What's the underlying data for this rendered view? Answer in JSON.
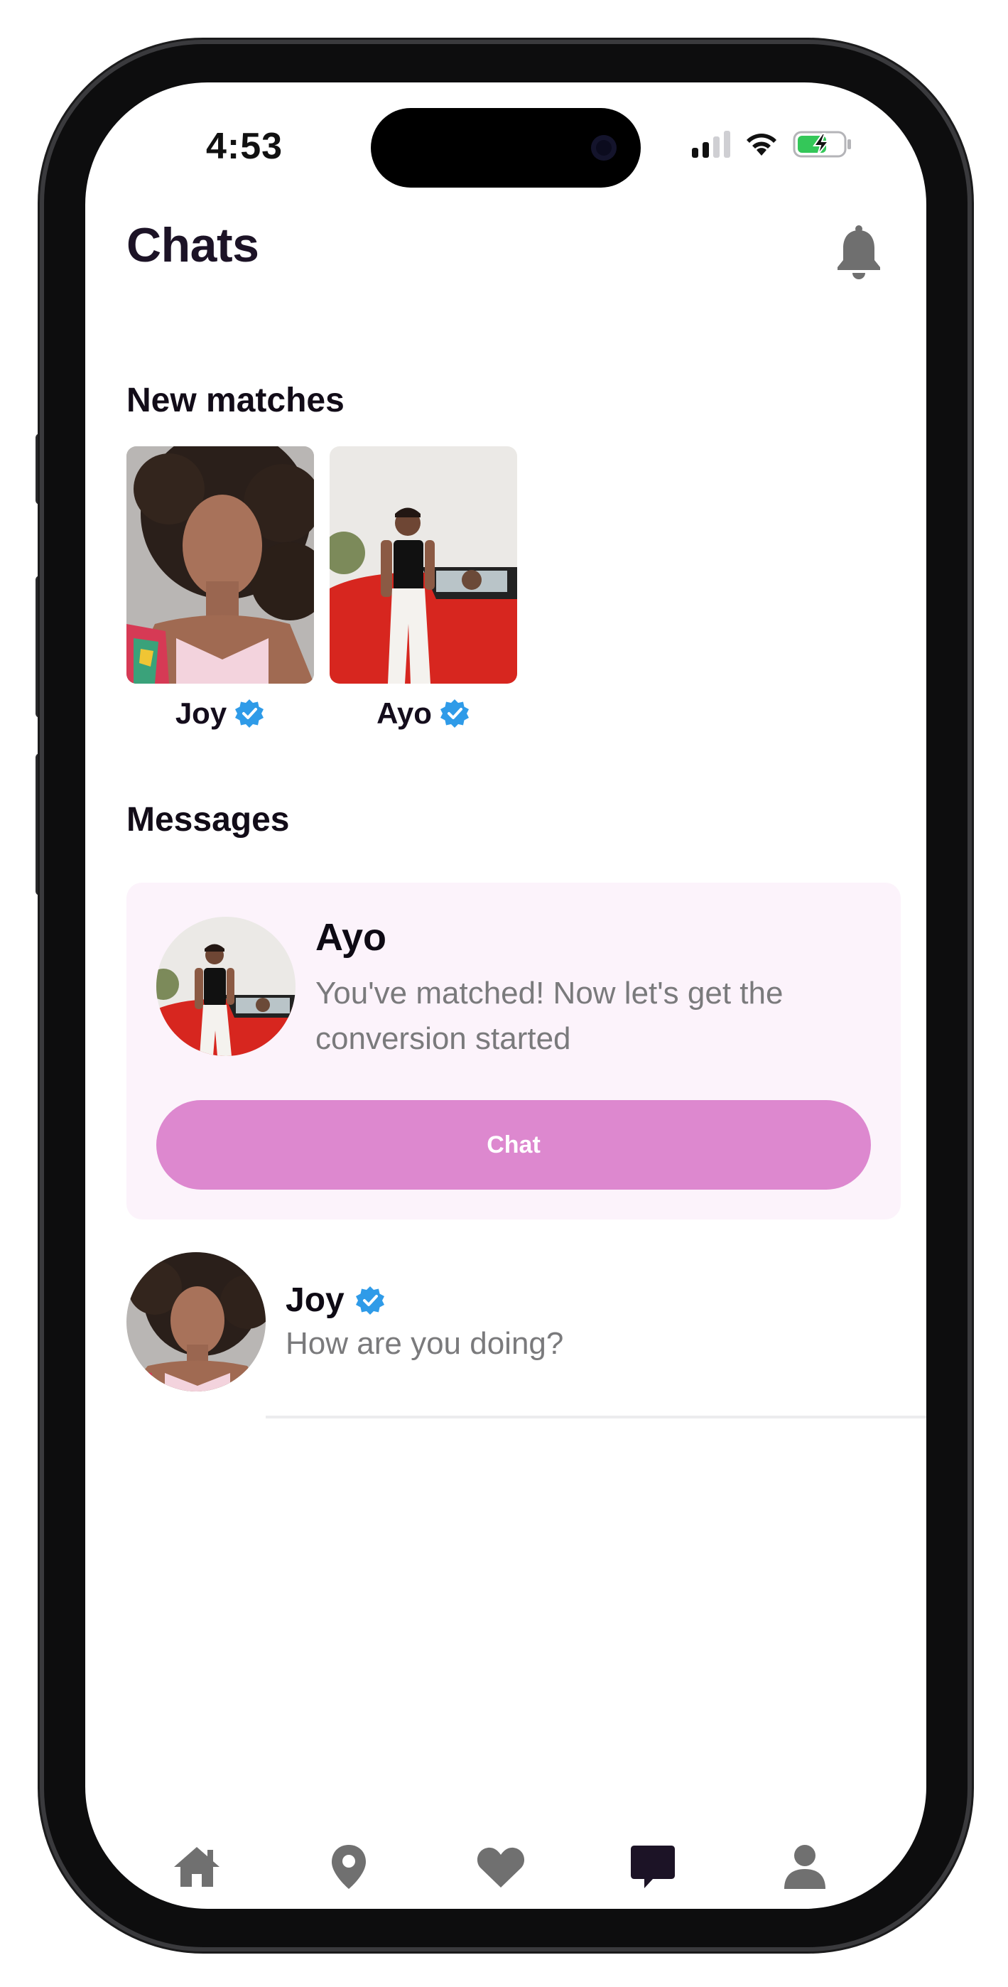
{
  "status_bar": {
    "time": "4:53",
    "battery_icon": "battery-charging-icon",
    "wifi_icon": "wifi-icon",
    "signal_icon": "cellular-signal-icon"
  },
  "header": {
    "title": "Chats",
    "notification_icon": "bell-icon"
  },
  "new_matches": {
    "label": "New matches",
    "items": [
      {
        "name": "Joy",
        "verified": true
      },
      {
        "name": "Ayo",
        "verified": true
      }
    ]
  },
  "messages": {
    "label": "Messages",
    "featured": {
      "name": "Ayo",
      "text": "You've matched! Now let's get the conversion started",
      "button_label": "Chat"
    },
    "conversations": [
      {
        "name": "Joy",
        "verified": true,
        "preview": "How are you doing?"
      }
    ]
  },
  "tab_bar": {
    "items": [
      {
        "icon": "home-icon",
        "active": false
      },
      {
        "icon": "location-pin-icon",
        "active": false
      },
      {
        "icon": "heart-icon",
        "active": false
      },
      {
        "icon": "chat-bubble-icon",
        "active": true
      },
      {
        "icon": "profile-icon",
        "active": false
      }
    ]
  },
  "colors": {
    "accent": "#dd88cf",
    "card_bg": "#fcf3fb",
    "verified": "#2f9be8",
    "tab_active": "#1c1326",
    "tab_inactive": "#707070",
    "battery_fill": "#34c759"
  }
}
